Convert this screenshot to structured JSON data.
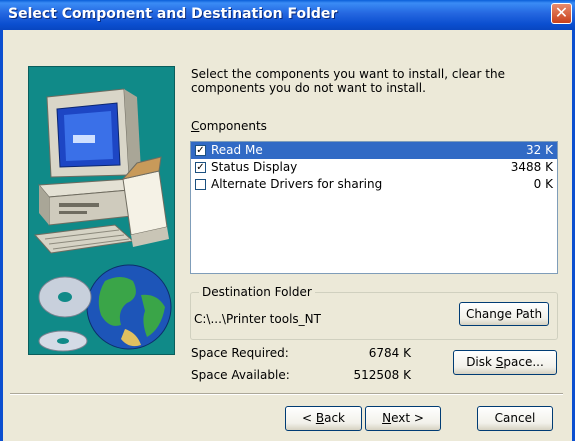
{
  "window": {
    "title": "Select Component and Destination Folder",
    "close_glyph": "✕"
  },
  "intro": "Select the components you want to install, clear the components you do not want to install.",
  "components": {
    "label_hotkey": "C",
    "label_rest": "omponents",
    "items": [
      {
        "label": "Read Me",
        "size": "32 K",
        "checked": true,
        "selected": true
      },
      {
        "label": "Status Display",
        "size": "3488 K",
        "checked": true,
        "selected": false
      },
      {
        "label": "Alternate Drivers for sharing",
        "size": "0 K",
        "checked": false,
        "selected": false
      }
    ]
  },
  "destination": {
    "legend": "Destination Folder",
    "path": "C:\\...\\Printer tools_NT",
    "change_button": "Change Path"
  },
  "space": {
    "required_label": "Space Required:",
    "required_value": "6784 K",
    "available_label": "Space Available:",
    "available_value": "512508 K",
    "disk_button_pre": "Disk ",
    "disk_button_hotkey": "S",
    "disk_button_post": "pace..."
  },
  "buttons": {
    "back_pre": "< ",
    "back_hotkey": "B",
    "back_post": "ack",
    "next_hotkey": "N",
    "next_post": "ext >",
    "cancel": "Cancel"
  },
  "colors": {
    "titlebar": "#0b4fd0",
    "selection": "#316ac5",
    "art_background": "#108a88"
  },
  "icons": [
    "close-icon",
    "computer-illustration",
    "cd-disc-illustration",
    "globe-illustration",
    "checkbox-icon"
  ]
}
